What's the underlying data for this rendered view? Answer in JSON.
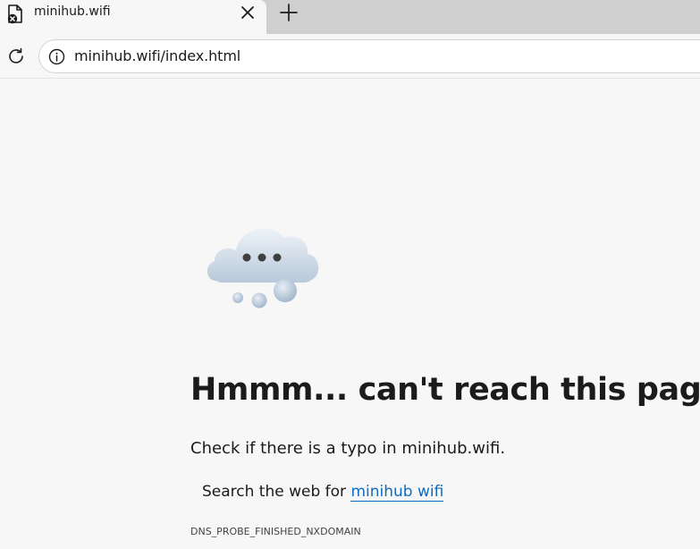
{
  "browser": {
    "tab": {
      "title": "minihub.wifi",
      "favicon": "error-page-icon",
      "close_icon": "close-icon"
    },
    "new_tab_icon": "plus-icon",
    "toolbar": {
      "reload_icon": "reload-icon",
      "site_info_icon": "info-icon",
      "address": "minihub.wifi/index.html"
    }
  },
  "error_page": {
    "illustration": "cloud-icon",
    "headline": "Hmmm... can't reach this page",
    "check_prefix": "Check if there is a typo in ",
    "check_host": "minihub.wifi",
    "check_suffix": ".",
    "search_prefix": "Search the web for ",
    "search_query": "minihub wifi",
    "error_code": "DNS_PROBE_FINISHED_NXDOMAIN"
  },
  "colors": {
    "page_background": "#f7f7f7",
    "tabstrip_background": "#cfcfcf",
    "link": "#0f6cbd",
    "text": "#1b1b1b"
  }
}
